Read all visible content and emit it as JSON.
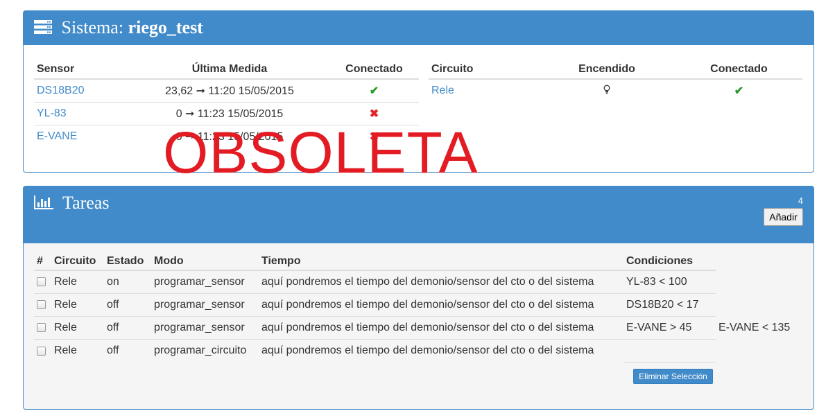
{
  "sistema": {
    "title_prefix": "Sistema:",
    "title_name": "riego_test",
    "sensor_headers": [
      "Sensor",
      "Última Medida",
      "Conectado"
    ],
    "sensors": [
      {
        "name": "DS18B20",
        "medida": "23,62 ➞ 11:20 15/05/2015",
        "connected": "✔"
      },
      {
        "name": "YL-83",
        "medida": "0 ➞ 11:23 15/05/2015",
        "connected": "✖"
      },
      {
        "name": "E-VANE",
        "medida": "0 ➞ 11:23 15/05/2015",
        "connected": "✖"
      }
    ],
    "circuit_headers": [
      "Circuito",
      "Encendido",
      "Conectado"
    ],
    "circuits": [
      {
        "name": "Rele",
        "encendido_icon": "lightbulb-icon",
        "connected": "✔"
      }
    ]
  },
  "tareas": {
    "title": "Tareas",
    "count": "4",
    "add_label": "Añadir",
    "headers": [
      "#",
      "Circuito",
      "Estado",
      "Modo",
      "Tiempo",
      "Condiciones",
      ""
    ],
    "rows": [
      {
        "circuito": "Rele",
        "estado": "on",
        "modo": "programar_sensor",
        "tiempo": "aquí pondremos el tiempo del demonio/sensor del cto o del sistema",
        "cond1": "YL-83 < 100",
        "cond2": ""
      },
      {
        "circuito": "Rele",
        "estado": "off",
        "modo": "programar_sensor",
        "tiempo": "aquí pondremos el tiempo del demonio/sensor del cto o del sistema",
        "cond1": "DS18B20 < 17",
        "cond2": ""
      },
      {
        "circuito": "Rele",
        "estado": "off",
        "modo": "programar_sensor",
        "tiempo": "aquí pondremos el tiempo del demonio/sensor del cto o del sistema",
        "cond1": "E-VANE > 45",
        "cond2": "E-VANE < 135"
      },
      {
        "circuito": "Rele",
        "estado": "off",
        "modo": "programar_circuito",
        "tiempo": "aquí pondremos el tiempo del demonio/sensor del cto o del sistema",
        "cond1": "",
        "cond2": ""
      }
    ],
    "delete_label": "Eliminar Selección"
  },
  "watermark": "OBSOLETA",
  "colors": {
    "panel": "#428bca",
    "ok": "#2a9a2a",
    "error": "#e0242a",
    "watermark": "#e31c24"
  }
}
